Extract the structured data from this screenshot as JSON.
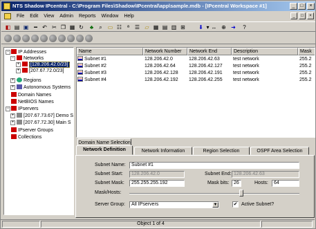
{
  "window": {
    "title": "NTS Shadow IPcentral - C:\\Program Files\\Shadow\\IPcentral\\app\\sample.mdb - [IPcentral Workspace #1]"
  },
  "title_buttons": [
    "_",
    "□",
    "×"
  ],
  "menu": [
    "File",
    "Edit",
    "View",
    "Admin",
    "Reports",
    "Window",
    "Help"
  ],
  "mdi_buttons": [
    "_",
    "□",
    "×"
  ],
  "tree": {
    "root": "IP Addresses",
    "networks": "Networks",
    "network1": "[128.206.42.0/23]",
    "network2": "[207.67.72.0/23]",
    "regions": "Regions",
    "autonomous": "Autonomous Systems",
    "domains": "Domain Names",
    "netbios": "NetBIOS Names",
    "ipservers": "IPservers",
    "server1": "[207.67.73.67] Demo S",
    "server2": "[207.67.72.30] Main S",
    "ipserver_groups": "IPserver Groups",
    "collections": "Collections"
  },
  "list": {
    "columns": [
      "Name",
      "Network Number",
      "Network End",
      "Description",
      "Mask"
    ],
    "rows": [
      {
        "name": "Subnet #1",
        "number": "128.206.42.0",
        "end": "128.206.42.63",
        "desc": "test network",
        "mask": "255.2"
      },
      {
        "name": "Subnet #2",
        "number": "128.206.42.64",
        "end": "128.206.42.127",
        "desc": "test network",
        "mask": "255.2"
      },
      {
        "name": "Subnet #3",
        "number": "128.206.42.128",
        "end": "128.206.42.191",
        "desc": "test network",
        "mask": "255.2"
      },
      {
        "name": "Subnet #4",
        "number": "128.206.42.192",
        "end": "128.206.42.255",
        "desc": "test network",
        "mask": "255.2"
      }
    ]
  },
  "tabs": {
    "domain_name_selection": "Domain Name Selection",
    "network_definition": "Network Definition",
    "network_information": "Network Information",
    "region_selection": "Region Selection",
    "ospf_area_selection": "OSPF Area Selection"
  },
  "form": {
    "subnet_name_label": "Subnet Name:",
    "subnet_name_value": "Subnet #1",
    "subnet_start_label": "Subnet Start:",
    "subnet_start_value": "128.206.42.0",
    "subnet_end_label": "Subnet End:",
    "subnet_end_value": "128.206.42.63",
    "subnet_mask_label": "Subnet Mask:",
    "subnet_mask_value": "255.255.255.192",
    "mask_bits_label": "Mask bits:",
    "mask_bits_value": "26",
    "hosts_label": "Hosts:",
    "hosts_value": "64",
    "mask_hosts_label": "Mask/Hosts:",
    "server_group_label": "Server Group:",
    "server_group_value": "All IPservers",
    "active_subnet_label": "Active Subnet?",
    "active_subnet_checked": true
  },
  "status": {
    "text": "Object 1 of 4"
  }
}
